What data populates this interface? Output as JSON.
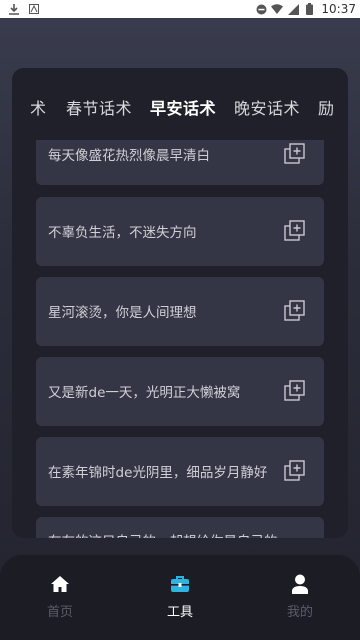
{
  "status": {
    "time": "10:37"
  },
  "tabs": [
    {
      "label": "术"
    },
    {
      "label": "春节话术"
    },
    {
      "label": "早安话术",
      "active": true
    },
    {
      "label": "晚安话术"
    },
    {
      "label": "励"
    }
  ],
  "cards": [
    "每天像盛花热烈像晨早清白",
    "不辜负生活，不迷失方向",
    "星河滚烫，你是人间理想",
    "又是新de一天，光明正大懒被窝",
    "在素年锦时de光阴里，细品岁月静好",
    "在在的这只自己的，却想给你是自己的"
  ],
  "nav": {
    "items": [
      {
        "label": "首页",
        "icon": "home-icon"
      },
      {
        "label": "工具",
        "icon": "toolbox-icon",
        "active": true
      },
      {
        "label": "我的",
        "icon": "user-icon"
      }
    ]
  },
  "colors": {
    "accent": "#2fb3e0",
    "card": "#353645",
    "panel": "#1f2029"
  }
}
